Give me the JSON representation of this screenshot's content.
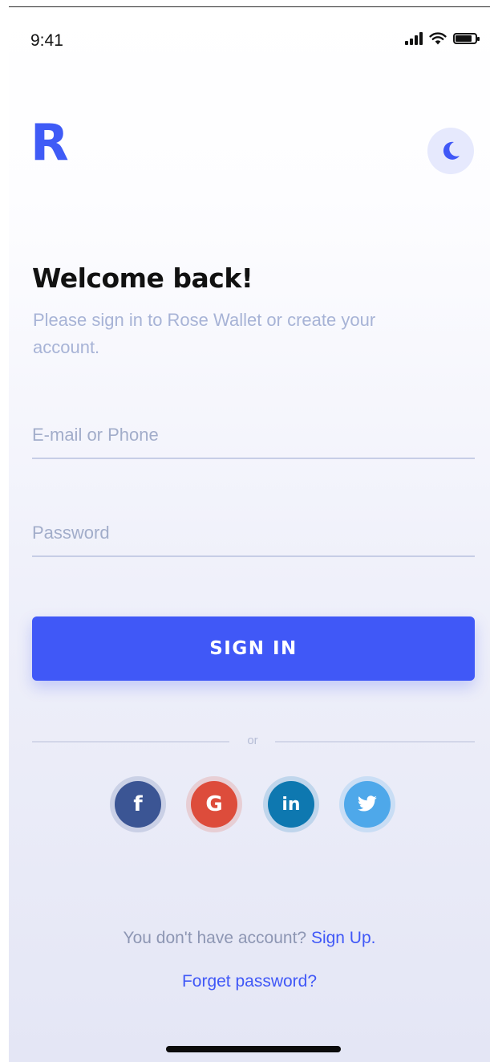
{
  "status_bar": {
    "time": "9:41",
    "icons": [
      "signal-icon",
      "wifi-icon",
      "battery-icon"
    ],
    "battery_level": 0.85
  },
  "brand": {
    "logo_letter": "R",
    "accent_color": "#4058f7",
    "theme_icon": "moon-icon"
  },
  "header": {
    "title": "Welcome back!",
    "subtitle": "Please sign in to Rose Wallet or create your account."
  },
  "form": {
    "email": {
      "value": "",
      "placeholder": "E-mail or Phone"
    },
    "password": {
      "value": "",
      "placeholder": "Password"
    },
    "submit_label": "SIGN IN"
  },
  "divider": {
    "label": "or"
  },
  "social": [
    {
      "name": "facebook",
      "icon": "facebook-icon",
      "glyph": "f",
      "color": "#3b5594"
    },
    {
      "name": "google",
      "icon": "google-icon",
      "glyph": "G",
      "color": "#dd4c3b"
    },
    {
      "name": "linkedin",
      "icon": "linkedin-icon",
      "glyph": "in",
      "color": "#0e78b0"
    },
    {
      "name": "twitter",
      "icon": "twitter-icon",
      "glyph": "",
      "color": "#4ea8ea"
    }
  ],
  "footer": {
    "no_account_text": "You don't have account?",
    "signup_label": "Sign Up.",
    "forgot_label": "Forget password?"
  }
}
